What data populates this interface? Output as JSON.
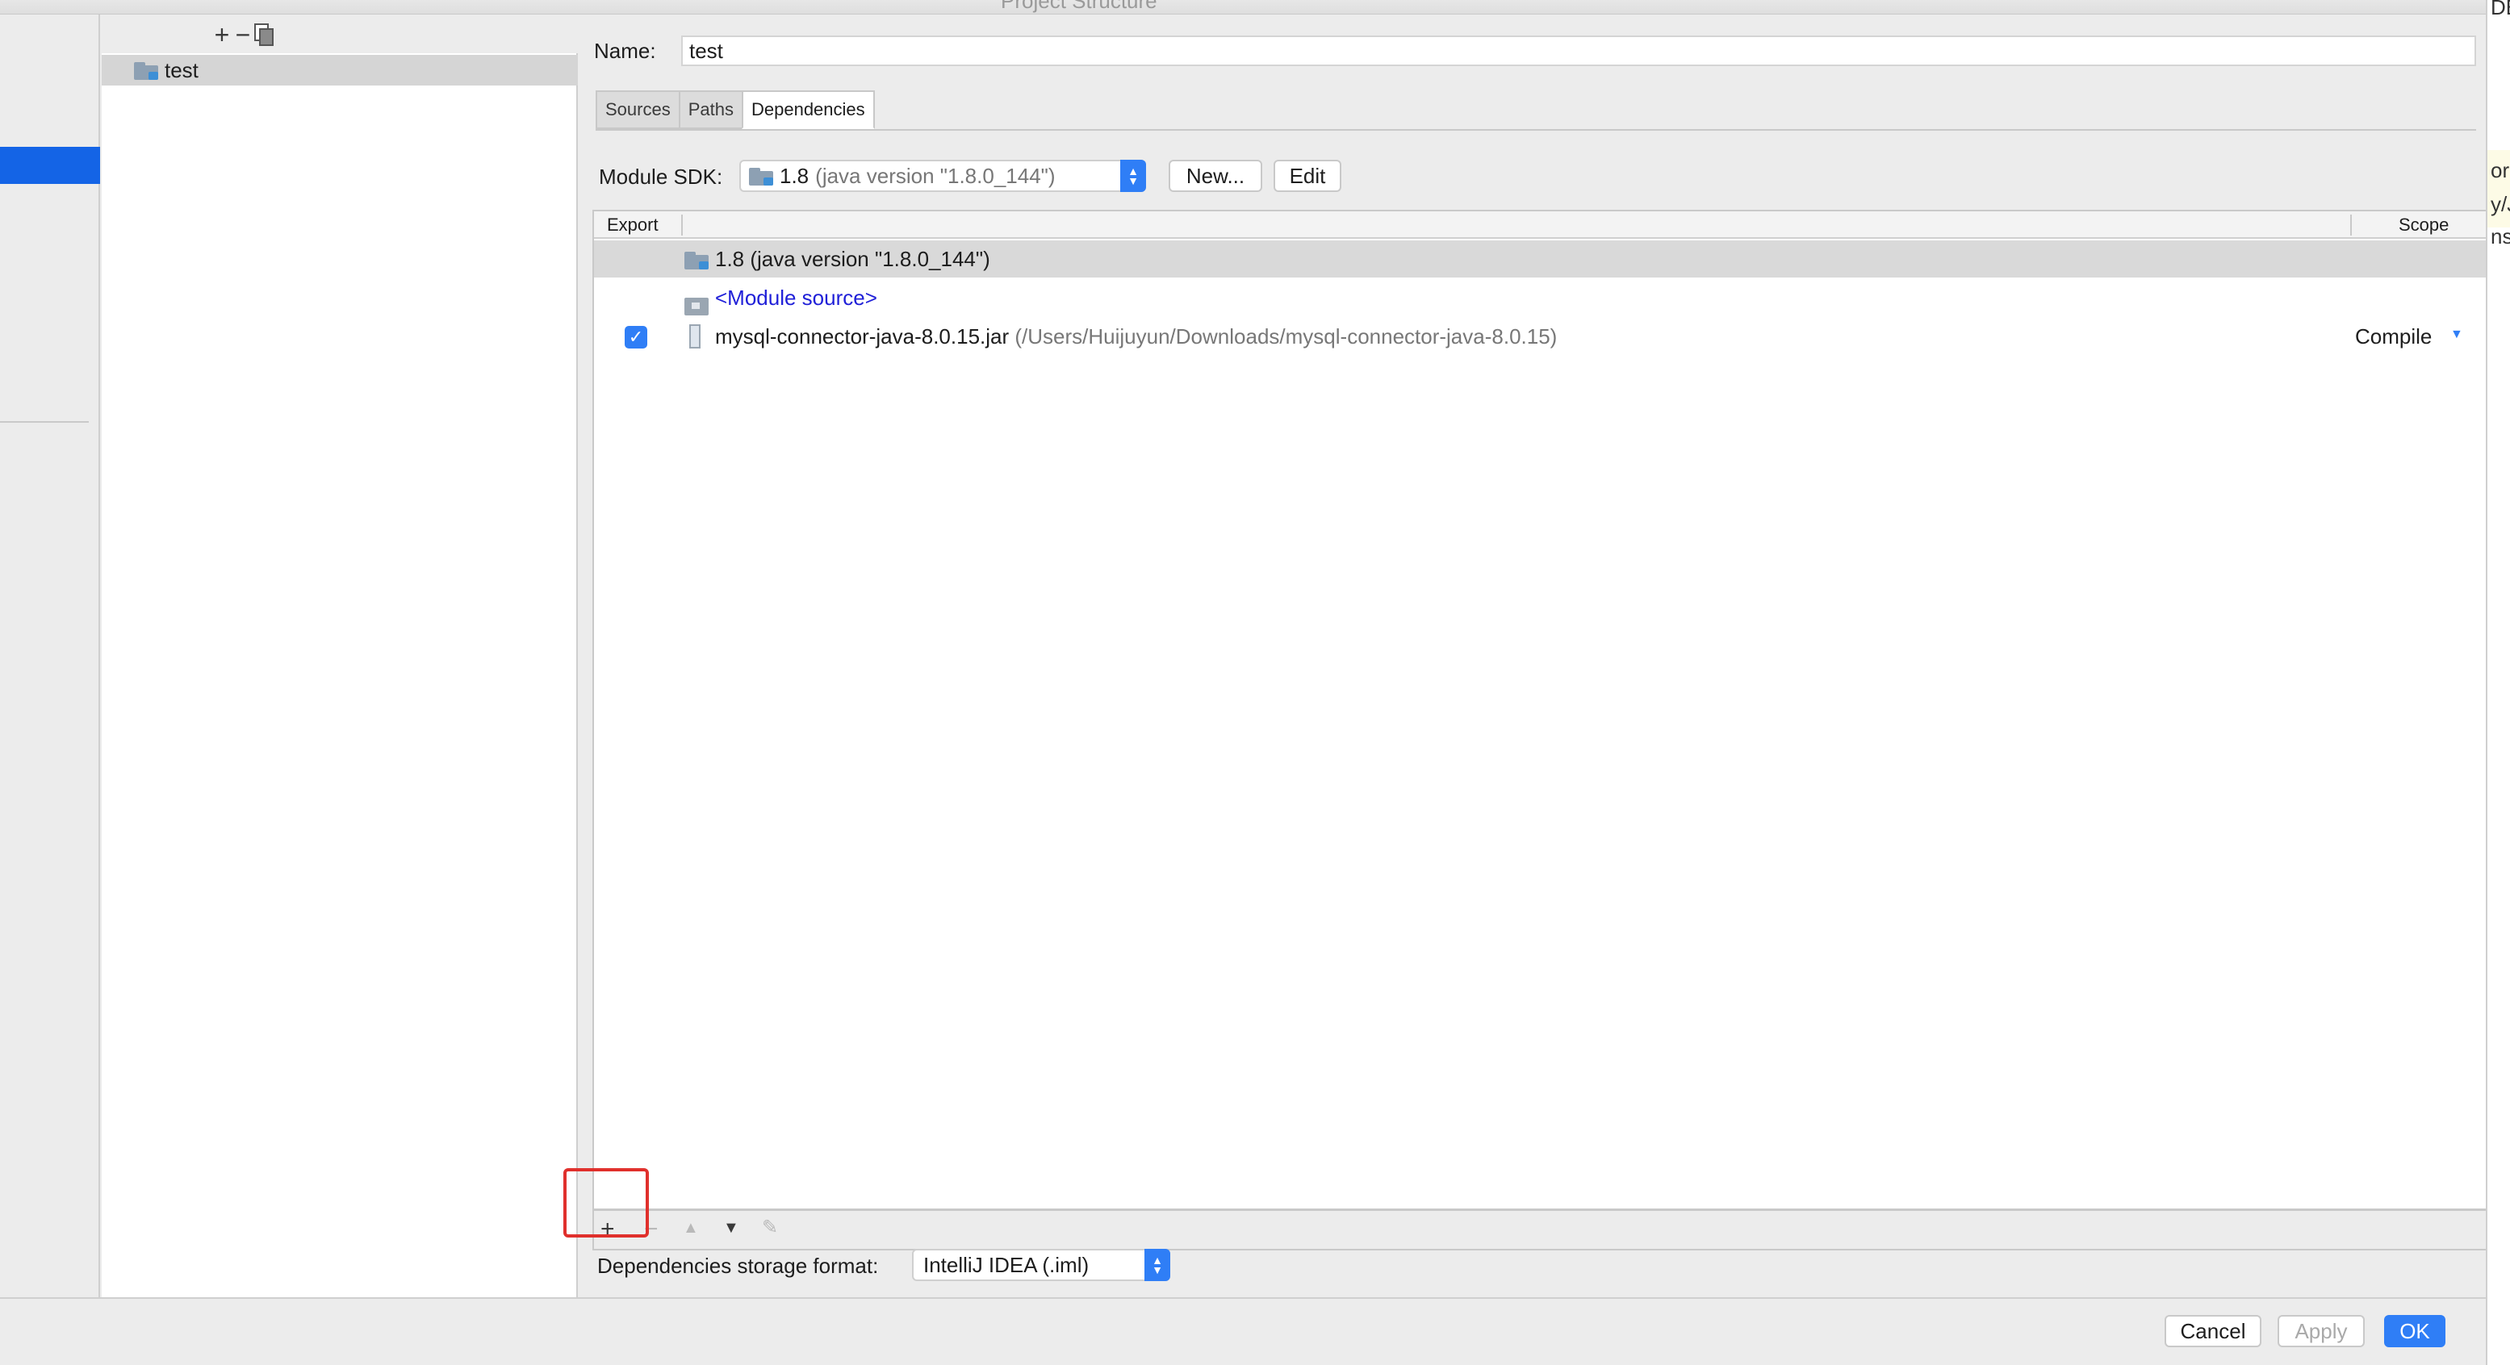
{
  "window": {
    "title": "Project Structure"
  },
  "tree": {
    "toolbar": {
      "add": "+",
      "remove": "−"
    },
    "items": [
      {
        "label": "test"
      }
    ]
  },
  "module": {
    "name_label": "Name:",
    "name_value": "test"
  },
  "tabs": [
    {
      "label": "Sources"
    },
    {
      "label": "Paths"
    },
    {
      "label": "Dependencies",
      "active": true
    }
  ],
  "sdk": {
    "label": "Module SDK:",
    "version": "1.8",
    "detail": "(java version \"1.8.0_144\")",
    "new_button": "New...",
    "edit_button": "Edit"
  },
  "table": {
    "col_export": "Export",
    "col_scope": "Scope",
    "rows": [
      {
        "name": "1.8 (java version \"1.8.0_144\")"
      },
      {
        "name": "<Module source>"
      },
      {
        "name": "mysql-connector-java-8.0.15.jar",
        "path": "(/Users/Huijuyun/Downloads/mysql-connector-java-8.0.15)",
        "export_checked": true,
        "scope": "Compile"
      }
    ]
  },
  "storage": {
    "label": "Dependencies storage format:",
    "value": "IntelliJ IDEA (.iml)"
  },
  "footer": {
    "cancel": "Cancel",
    "apply": "Apply",
    "ok": "OK"
  },
  "background_window": {
    "fragments": [
      "DB",
      "or-",
      "y/Ja",
      "nsc"
    ]
  },
  "colors": {
    "accent": "#2f7ef6",
    "selection": "#1464e6",
    "highlight": "#e0302c"
  }
}
